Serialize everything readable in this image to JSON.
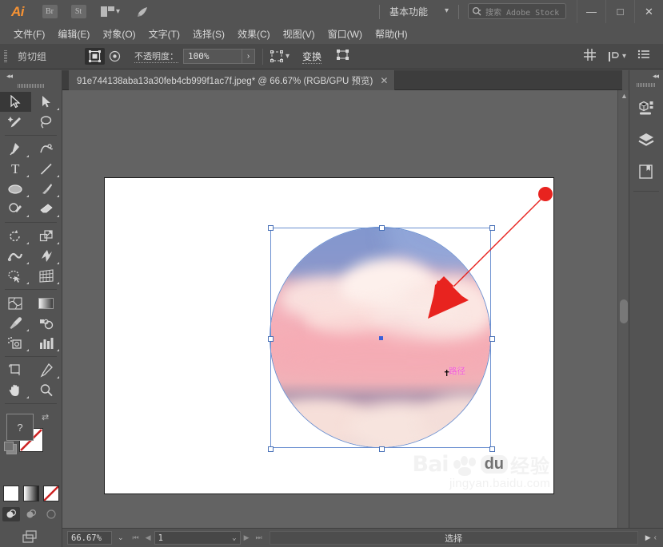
{
  "app": {
    "logo": "Ai",
    "quick_buttons": [
      {
        "name": "bridge",
        "label": "Br"
      },
      {
        "name": "stock",
        "label": "St"
      }
    ],
    "arrange_icon": "arrange-documents-icon",
    "rocket_icon": "rocket-icon",
    "workspace": "基本功能",
    "stock_search_placeholder": "搜索 Adobe Stock",
    "window_buttons": [
      {
        "name": "minimize",
        "glyph": "—"
      },
      {
        "name": "maximize",
        "glyph": "□"
      },
      {
        "name": "close",
        "glyph": "✕"
      }
    ]
  },
  "menubar": {
    "items": [
      "文件(F)",
      "编辑(E)",
      "对象(O)",
      "文字(T)",
      "选择(S)",
      "效果(C)",
      "视图(V)",
      "窗口(W)",
      "帮助(H)"
    ]
  },
  "controlbar": {
    "selection_label": "剪切组",
    "isolate_icons": [
      "isolate-group-icon",
      "target-icon"
    ],
    "opacity_label": "不透明度：",
    "opacity_value": "100%",
    "opacity_arrow": "›",
    "transform_mode_icon": "align-bounds-icon",
    "transform_label": "变换",
    "envelope_icon": "envelope-distort-icon",
    "right_icons": [
      "align-icon",
      "distribute-icon",
      "chevron-down-icon",
      "document-setup-icon"
    ]
  },
  "document": {
    "tab_title": "91e744138aba13a30feb4cb999f1ac7f.jpeg* @ 66.67% (RGB/GPU 预览)",
    "close_glyph": "✕"
  },
  "toolbar": {
    "collapse_glyph": "◂◂",
    "tools": [
      {
        "name": "selection-tool",
        "glyph": "selection",
        "selected": true,
        "corner": false
      },
      {
        "name": "direct-selection-tool",
        "glyph": "direct-selection",
        "selected": false,
        "corner": true
      },
      {
        "name": "magic-wand-tool",
        "glyph": "magic-wand",
        "selected": false,
        "corner": false
      },
      {
        "name": "lasso-tool",
        "glyph": "lasso",
        "selected": false,
        "corner": false
      },
      {
        "name": "pen-tool",
        "glyph": "pen",
        "selected": false,
        "corner": true
      },
      {
        "name": "curvature-tool",
        "glyph": "curvature",
        "selected": false,
        "corner": false
      },
      {
        "name": "type-tool",
        "glyph": "type",
        "selected": false,
        "corner": true
      },
      {
        "name": "line-segment-tool",
        "glyph": "line",
        "selected": false,
        "corner": true
      },
      {
        "name": "ellipse-tool",
        "glyph": "ellipse",
        "selected": false,
        "corner": true
      },
      {
        "name": "paintbrush-tool",
        "glyph": "paintbrush",
        "selected": false,
        "corner": true
      },
      {
        "name": "shaper-tool",
        "glyph": "shaper",
        "selected": false,
        "corner": true
      },
      {
        "name": "eraser-tool",
        "glyph": "eraser",
        "selected": false,
        "corner": true
      },
      {
        "name": "rotate-tool",
        "glyph": "rotate",
        "selected": false,
        "corner": true
      },
      {
        "name": "scale-tool",
        "glyph": "scale",
        "selected": false,
        "corner": true
      },
      {
        "name": "width-tool",
        "glyph": "width",
        "selected": false,
        "corner": true
      },
      {
        "name": "free-transform-tool",
        "glyph": "free-transform",
        "selected": false,
        "corner": true
      },
      {
        "name": "shape-builder-tool",
        "glyph": "shape-builder",
        "selected": false,
        "corner": true
      },
      {
        "name": "perspective-grid-tool",
        "glyph": "perspective-grid",
        "selected": false,
        "corner": true
      },
      {
        "name": "mesh-tool",
        "glyph": "mesh",
        "selected": false,
        "corner": false
      },
      {
        "name": "gradient-tool",
        "glyph": "gradient",
        "selected": false,
        "corner": false
      },
      {
        "name": "eyedropper-tool",
        "glyph": "eyedropper",
        "selected": false,
        "corner": true
      },
      {
        "name": "blend-tool",
        "glyph": "blend",
        "selected": false,
        "corner": false
      },
      {
        "name": "symbol-sprayer-tool",
        "glyph": "symbol-sprayer",
        "selected": false,
        "corner": true
      },
      {
        "name": "column-graph-tool",
        "glyph": "column-graph",
        "selected": false,
        "corner": true
      },
      {
        "name": "artboard-tool",
        "glyph": "artboard",
        "selected": false,
        "corner": false
      },
      {
        "name": "slice-tool",
        "glyph": "slice",
        "selected": false,
        "corner": true
      },
      {
        "name": "hand-tool",
        "glyph": "hand",
        "selected": false,
        "corner": true
      },
      {
        "name": "zoom-tool",
        "glyph": "zoom",
        "selected": false,
        "corner": false
      }
    ],
    "help_glyph": "?",
    "swap_glyph": "⇄",
    "swatches": [
      {
        "name": "color-swatch",
        "kind": "white"
      },
      {
        "name": "gradient-swatch",
        "kind": "gradient"
      },
      {
        "name": "none-swatch",
        "kind": "none"
      }
    ],
    "draw_modes": [
      {
        "name": "draw-normal-mode",
        "active": true
      },
      {
        "name": "draw-behind-mode",
        "active": false
      },
      {
        "name": "draw-inside-mode",
        "active": false
      }
    ],
    "screen_mode_icon": "change-screen-mode-icon"
  },
  "canvas": {
    "artwork_name": "sky-clouds-circle-image",
    "path_label": "路径",
    "cursor_icon": "pointer-crosshair",
    "annotation_arrow": {
      "name": "red-arrow-annotation",
      "color": "#e8231f"
    },
    "selection_color": "#6a8fd0",
    "anchor_fill": "#ffffff",
    "center_point_color": "#3b5fd8"
  },
  "watermark": {
    "brand": "Bai",
    "brand_du": "du",
    "brand_cn": "经验",
    "url": "jingyan.baidu.com",
    "paw_icon": "baidu-paw-icon"
  },
  "rightdock": {
    "collapse_glyph": "◂◂",
    "panels": [
      {
        "name": "panel-properties",
        "icon": "properties-icon"
      },
      {
        "name": "panel-layers",
        "icon": "layers-icon"
      },
      {
        "name": "panel-libraries",
        "icon": "libraries-icon"
      }
    ]
  },
  "statusbar": {
    "zoom_value": "66.67%",
    "zoom_chevron": "⌄",
    "nav_first": "⏮",
    "nav_prev": "◀",
    "page_value": "1",
    "page_chevron": "⌄",
    "nav_next": "▶",
    "nav_last": "⏭",
    "status_text": "选择",
    "status_arrow": "▶",
    "status_chevron": "‹"
  }
}
